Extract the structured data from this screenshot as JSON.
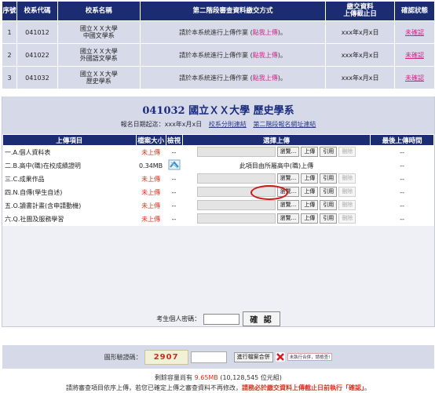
{
  "top_table": {
    "headers": [
      "序號",
      "校系代碼",
      "校系名稱",
      "第二階段審查資料繳交方式",
      "繳交資料\n上傳截止日",
      "確認狀態"
    ],
    "rows": [
      {
        "no": "1",
        "code": "041012",
        "name": "國立ＸＸ大學\n中國文學系",
        "notice_prefix": "請於本系統進行上傳作業 (",
        "notice_link": "點我上傳",
        "notice_suffix": ")。",
        "deadline": "xxx年x月x日",
        "status": "未確認"
      },
      {
        "no": "2",
        "code": "041022",
        "name": "國立ＸＸ大學\n外國語文學系",
        "notice_prefix": "請於本系統進行上傳作業 (",
        "notice_link": "點我上傳",
        "notice_suffix": ")。",
        "deadline": "xxx年x月x日",
        "status": "未確認"
      },
      {
        "no": "3",
        "code": "041032",
        "name": "國立ＸＸ大學\n歷史學系",
        "notice_prefix": "請於本系統進行上傳作業 (",
        "notice_link": "點我上傳",
        "notice_suffix": ")。",
        "deadline": "xxx年x月x日",
        "status": "未確認"
      }
    ]
  },
  "panel": {
    "title": "041032 國立ＸＸ大學 歷史學系",
    "subtitle_prefix": "報名日期起迄：xxx年x月x日",
    "link1": "校系分則連結",
    "link2": "第二階段報名網址連結"
  },
  "upload_table": {
    "headers": [
      "上傳項目",
      "檔案大小",
      "檢視",
      "選擇上傳",
      "最後上傳時間"
    ],
    "rows": [
      {
        "item": "一.A.個人資料表",
        "size": "未上傳",
        "view": "--",
        "type": "file",
        "last": "--"
      },
      {
        "item": "二.B.高中(職)在校成績證明",
        "size": "0.34MB",
        "view": "",
        "type": "notice",
        "notice": "此項目由所屬高中(職)上傳",
        "last": "--"
      },
      {
        "item": "三.C.成果作品",
        "size": "未上傳",
        "view": "--",
        "type": "file",
        "last": "--"
      },
      {
        "item": "四.N.自傳(學生自述)",
        "size": "未上傳",
        "view": "--",
        "type": "file",
        "last": "--"
      },
      {
        "item": "五.O.讀書計畫(含申請動機)",
        "size": "未上傳",
        "view": "--",
        "type": "file",
        "last": "--"
      },
      {
        "item": "六.Q.社團及服務學習",
        "size": "未上傳",
        "view": "--",
        "type": "file",
        "last": "--"
      }
    ],
    "btn_browse": "瀏覽...",
    "btn_upload": "上傳",
    "btn_cite": "引用",
    "btn_delete": "刪除"
  },
  "captcha": {
    "label": "圖形驗證碼：",
    "code": "2907",
    "merge_btn": "進行檔案合併",
    "merge_note": "未執行合併，請檢查!"
  },
  "footer": {
    "line1_prefix": "剩餘容量尚有",
    "line1_value": "9.65MB",
    "line1_suffix": "(10,128,545 位元組)",
    "line2_normal": "請將審查項目依序上傳，若您已確定上傳之審查資料不再修改，",
    "line2_red": "請務必於繳交資料上傳截止日前執行「確認」",
    "line2_end": "。",
    "pwd_label": "考生個人密碼：",
    "confirm_btn": "確 認"
  },
  "colors": {
    "header_bg": "#1b2c73",
    "row_bg": "#d7dbe9",
    "accent_pink": "#d0288a",
    "alert_red": "#e0301e"
  }
}
